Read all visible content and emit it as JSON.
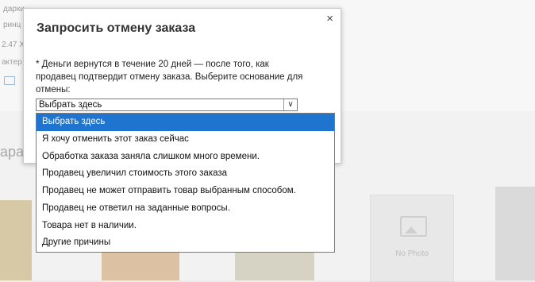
{
  "background": {
    "fragments": [
      "дарки",
      "ринц",
      "2.47 X",
      "актер"
    ],
    "section_title": "ара",
    "no_photo_label": "No Photo"
  },
  "modal": {
    "title": "Запросить отмену заказа",
    "close_icon": "×",
    "info_text": "* Деньги вернутся в течение 20 дней — после того, как продавец подтвердит отмену заказа. Выберите основание для отмены:"
  },
  "select": {
    "value": "Выбрать здесь",
    "arrow_icon": "chevron-down-icon",
    "arrow_glyph": "∨",
    "options": [
      "Выбрать здесь",
      "Я хочу отменить этот заказ сейчас",
      "Обработка заказа заняла слишком много времени.",
      "Продавец увеличил стоимость этого заказа",
      "Продавец не может отправить товар выбранным способом.",
      "Продавец не ответил на заданные вопросы.",
      "Товара нет в наличии.",
      "Другие причины"
    ],
    "selected_index": 0
  },
  "colors": {
    "highlight": "#1e74cf",
    "overlay": "#f2f2f2"
  }
}
